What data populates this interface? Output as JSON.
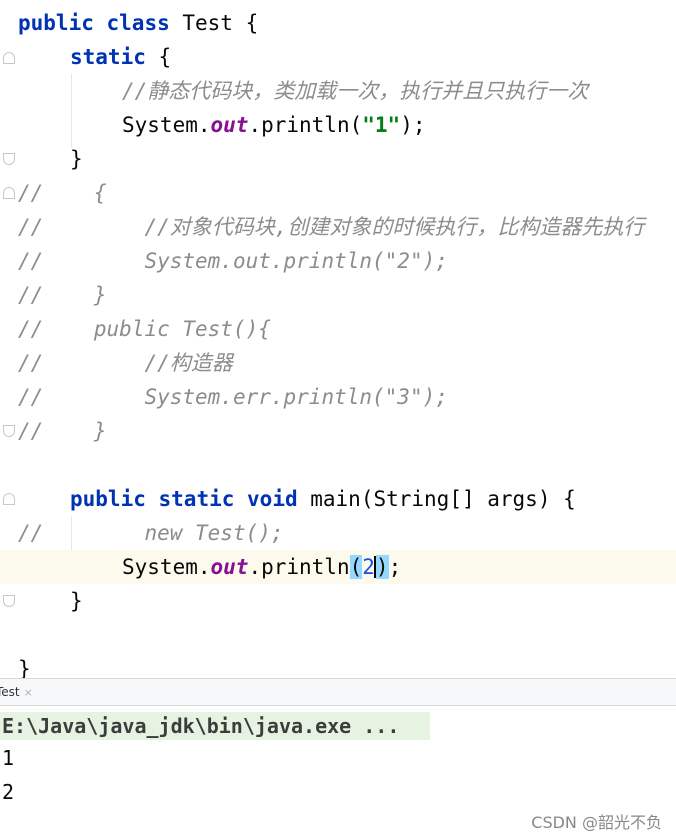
{
  "editor": {
    "lines": {
      "l1": {
        "pub": "public",
        "cls": "class",
        "name": " Test {"
      },
      "l2": {
        "kw": "static",
        "rest": " {"
      },
      "l3": {
        "comment": "//静态代码块，类加载一次，执行并且只执行一次"
      },
      "l4": {
        "sys": "System.",
        "field": "out",
        "call": ".println(",
        "str": "\"1\"",
        "end": ");"
      },
      "l5": {
        "text": "}"
      },
      "l6": {
        "prefix": "//",
        "text": "    {"
      },
      "l7": {
        "prefix": "//",
        "text": "        //对象代码块,创建对象的时候执行，比构造器先执行"
      },
      "l8": {
        "prefix": "//",
        "text": "        System.out.println(\"2\");"
      },
      "l9": {
        "prefix": "//",
        "text": "    }"
      },
      "l10": {
        "prefix": "//",
        "text": "    public Test(){"
      },
      "l11": {
        "prefix": "//",
        "text": "        //构造器"
      },
      "l12": {
        "prefix": "//",
        "text": "        System.err.println(\"3\");"
      },
      "l13": {
        "prefix": "//",
        "text": "    }"
      },
      "l15": {
        "pub": "public",
        "st": "static",
        "vd": "void",
        "rest": " main(String[] args) {"
      },
      "l16": {
        "prefix": "//",
        "text": "        new Test();"
      },
      "l17": {
        "sys": "System.",
        "field": "out",
        "call": ".println",
        "open": "(",
        "num": "2",
        "close": ")",
        "end": ";"
      },
      "l18": {
        "text": "}"
      },
      "l20": {
        "text": "}"
      }
    }
  },
  "run": {
    "tab_label": "Test",
    "tab_close": "×",
    "command": "E:\\Java\\java_jdk\\bin\\java.exe ...",
    "output": [
      "1",
      "2"
    ]
  },
  "watermark": "CSDN @韶光不负"
}
